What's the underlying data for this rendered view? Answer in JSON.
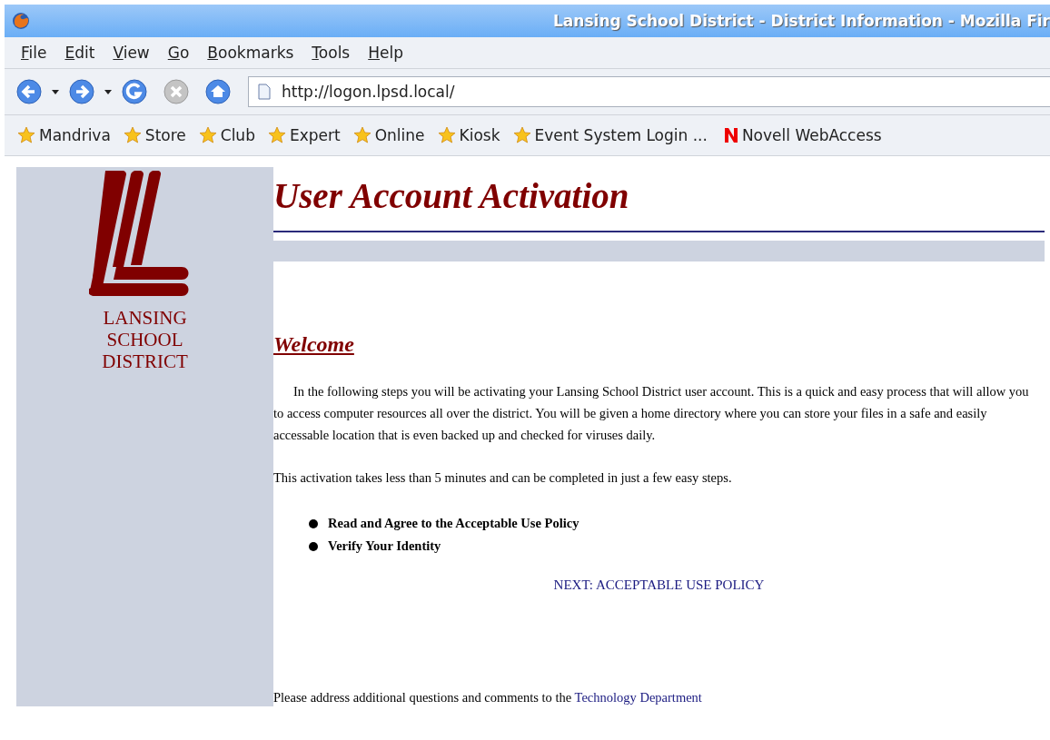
{
  "window": {
    "title": "Lansing School District - District Information - Mozilla Fir"
  },
  "menu": [
    "File",
    "Edit",
    "View",
    "Go",
    "Bookmarks",
    "Tools",
    "Help"
  ],
  "toolbar": {
    "address": "http://logon.lpsd.local/"
  },
  "bookmarks": [
    {
      "label": "Mandriva",
      "kind": "star"
    },
    {
      "label": "Store",
      "kind": "star"
    },
    {
      "label": "Club",
      "kind": "star"
    },
    {
      "label": "Expert",
      "kind": "star"
    },
    {
      "label": "Online",
      "kind": "star"
    },
    {
      "label": "Kiosk",
      "kind": "star"
    },
    {
      "label": "Event System Login ...",
      "kind": "star"
    },
    {
      "label": "Novell WebAccess",
      "kind": "novell"
    }
  ],
  "page": {
    "logo_lines": [
      "LANSING",
      "SCHOOL",
      "DISTRICT"
    ],
    "heading": "User Account Activation",
    "welcome": "Welcome",
    "paragraphs": [
      "In the following steps you will be activating your Lansing School District user account.  This is a quick and easy process that will allow you to access computer resources all over the district.  You will be given a home directory where you can store your files in a safe and easily accessable location that is even backed up and checked for viruses daily.",
      "This activation takes less than 5 minutes and can be completed in just a few easy steps."
    ],
    "steps": [
      "Read and Agree to the Acceptable Use Policy",
      "Verify Your Identity"
    ],
    "next_link": "NEXT:  ACCEPTABLE USE POLICY",
    "footer": {
      "text": "Please address additional questions and comments to the ",
      "link": "Technology Department"
    }
  }
}
